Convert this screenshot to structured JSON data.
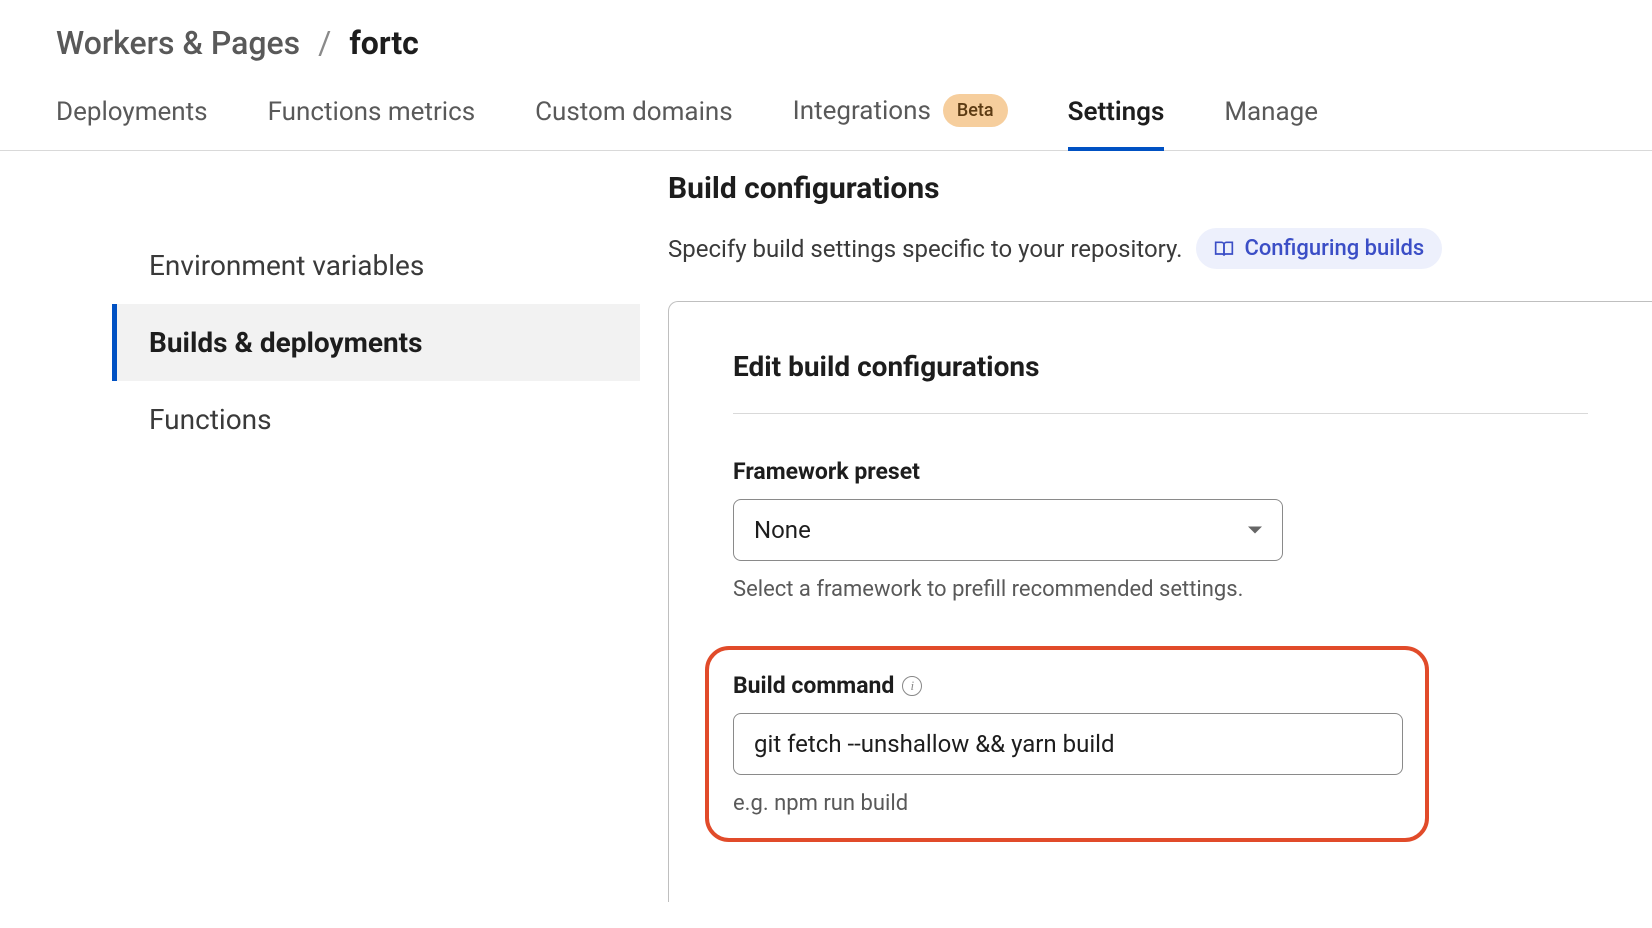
{
  "breadcrumb": {
    "root": "Workers & Pages",
    "current": "fortc"
  },
  "tabs": [
    {
      "label": "Deployments",
      "badge": null,
      "active": false
    },
    {
      "label": "Functions metrics",
      "badge": null,
      "active": false
    },
    {
      "label": "Custom domains",
      "badge": null,
      "active": false
    },
    {
      "label": "Integrations",
      "badge": "Beta",
      "active": false
    },
    {
      "label": "Settings",
      "badge": null,
      "active": true
    },
    {
      "label": "Manage",
      "badge": null,
      "active": false
    }
  ],
  "sidebar": {
    "items": [
      {
        "label": "Environment variables",
        "active": false
      },
      {
        "label": "Builds & deployments",
        "active": true
      },
      {
        "label": "Functions",
        "active": false
      }
    ]
  },
  "section": {
    "title": "Build configurations",
    "description": "Specify build settings specific to your repository.",
    "link_label": "Configuring builds"
  },
  "panel": {
    "title": "Edit build configurations",
    "framework": {
      "label": "Framework preset",
      "value": "None",
      "helper": "Select a framework to prefill recommended settings."
    },
    "build_command": {
      "label": "Build command",
      "value": "git fetch --unshallow && yarn build",
      "helper": "e.g. npm run build"
    }
  }
}
